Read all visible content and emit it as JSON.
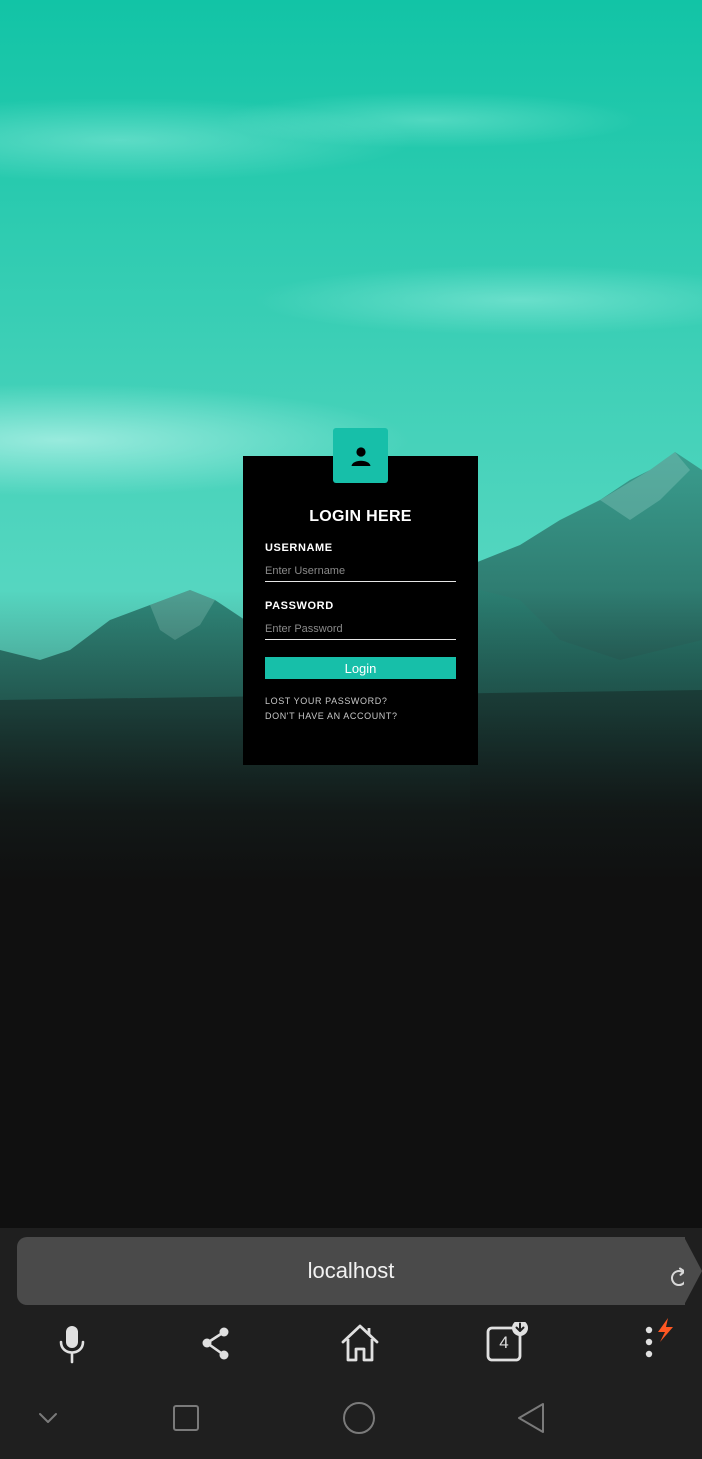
{
  "login": {
    "title": "LOGIN HERE",
    "username_label": "USERNAME",
    "username_placeholder": "Enter Username",
    "password_label": "PASSWORD",
    "password_placeholder": "Enter Password",
    "login_button": "Login",
    "lost_password_link": "LOST YOUR PASSWORD?",
    "no_account_link": "DON'T HAVE AN ACCOUNT?"
  },
  "browser": {
    "url": "localhost",
    "tab_count": "4",
    "toolbar_icons": [
      "microphone-icon",
      "share-icon",
      "home-icon",
      "tabs-icon",
      "menu-icon"
    ]
  },
  "nav": {
    "icons": [
      "chevron-down-icon",
      "recents-icon",
      "home-circle-icon",
      "back-icon"
    ]
  },
  "colors": {
    "accent": "#17bfa9",
    "card_bg": "#000000",
    "bar_bg": "#1f1f1f",
    "url_bg": "#4a4a4a",
    "notification": "#ff5722"
  }
}
